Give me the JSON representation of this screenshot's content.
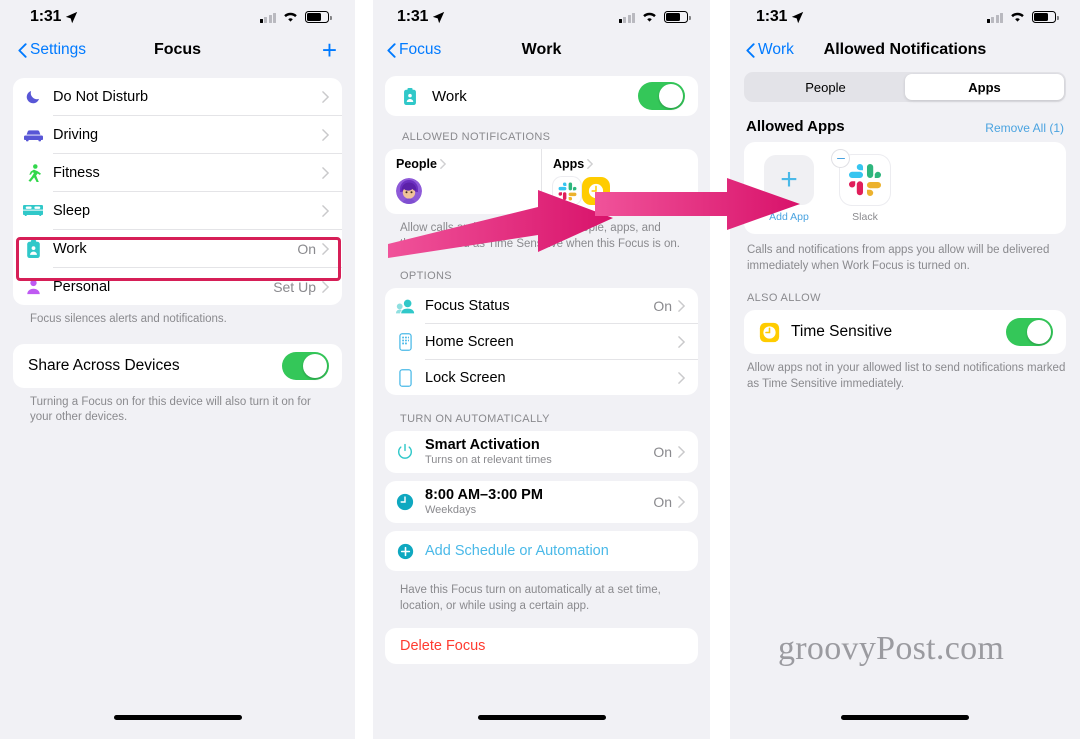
{
  "statusbar": {
    "time": "1:31"
  },
  "phone1": {
    "nav": {
      "back": "Settings",
      "title": "Focus",
      "add": "+"
    },
    "focus_modes": [
      {
        "label": "Do Not Disturb",
        "value": "",
        "icon": "moon-icon",
        "color": "#5856d6"
      },
      {
        "label": "Driving",
        "value": "",
        "icon": "car-icon",
        "color": "#5856d6"
      },
      {
        "label": "Fitness",
        "value": "",
        "icon": "running-icon",
        "color": "#32d74b"
      },
      {
        "label": "Sleep",
        "value": "",
        "icon": "bed-icon",
        "color": "#30c8c9"
      },
      {
        "label": "Work",
        "value": "On",
        "icon": "badge-icon",
        "color": "#30c8c9"
      },
      {
        "label": "Personal",
        "value": "Set Up",
        "icon": "person-icon",
        "color": "#bf5af2"
      }
    ],
    "focus_footnote": "Focus silences alerts and notifications.",
    "share": {
      "label": "Share Across Devices",
      "toggle_on": true,
      "footnote": "Turning a Focus on for this device will also turn it on for your other devices."
    },
    "highlight_color": "#d61f57"
  },
  "phone2": {
    "nav": {
      "back": "Focus",
      "title": "Work"
    },
    "work_toggle": {
      "label": "Work",
      "icon": "badge-icon",
      "on": true
    },
    "allowed_header": "ALLOWED NOTIFICATIONS",
    "people_card": {
      "title": "People",
      "avatar": "person-avatar"
    },
    "apps_card": {
      "title": "Apps",
      "apps": [
        "Slack",
        "Clock"
      ]
    },
    "allowed_footnote": "Allow calls and notifications from people, apps, and those marked as Time Sensitive when this Focus is on.",
    "options_header": "OPTIONS",
    "options": [
      {
        "label": "Focus Status",
        "value": "On",
        "icon": "focus-status-icon"
      },
      {
        "label": "Home Screen",
        "value": "",
        "icon": "home-screen-icon"
      },
      {
        "label": "Lock Screen",
        "value": "",
        "icon": "lock-screen-icon"
      }
    ],
    "auto_header": "TURN ON AUTOMATICALLY",
    "automations": [
      {
        "label": "Smart Activation",
        "sub": "Turns on at relevant times",
        "value": "On",
        "icon": "power-icon"
      },
      {
        "label": "8:00 AM–3:00 PM",
        "sub": "Weekdays",
        "value": "On",
        "icon": "clock-icon"
      }
    ],
    "add_schedule": {
      "label": "Add Schedule or Automation",
      "icon": "plus-circle-icon"
    },
    "auto_footnote": "Have this Focus turn on automatically at a set time, location, or while using a certain app.",
    "delete": {
      "label": "Delete Focus",
      "color": "#ff3b30"
    }
  },
  "phone3": {
    "nav": {
      "back": "Work",
      "title": "Allowed Notifications"
    },
    "segments": [
      {
        "label": "People",
        "active": false
      },
      {
        "label": "Apps",
        "active": true
      }
    ],
    "allowed_apps": {
      "title": "Allowed Apps",
      "action": "Remove All (1)",
      "items": [
        {
          "name": "Add App",
          "type": "add"
        },
        {
          "name": "Slack",
          "type": "app"
        }
      ],
      "footnote": "Calls and notifications from apps you allow will be delivered immediately when Work Focus is turned on."
    },
    "also_allow_header": "ALSO ALLOW",
    "time_sensitive": {
      "label": "Time Sensitive",
      "icon": "clock-badge-icon",
      "on": true,
      "footnote": "Allow apps not in your allowed list to send notifications marked as Time Sensitive immediately."
    }
  },
  "annotations": {
    "arrow_color": "#e0256d",
    "watermark": "groovyPost.com"
  }
}
